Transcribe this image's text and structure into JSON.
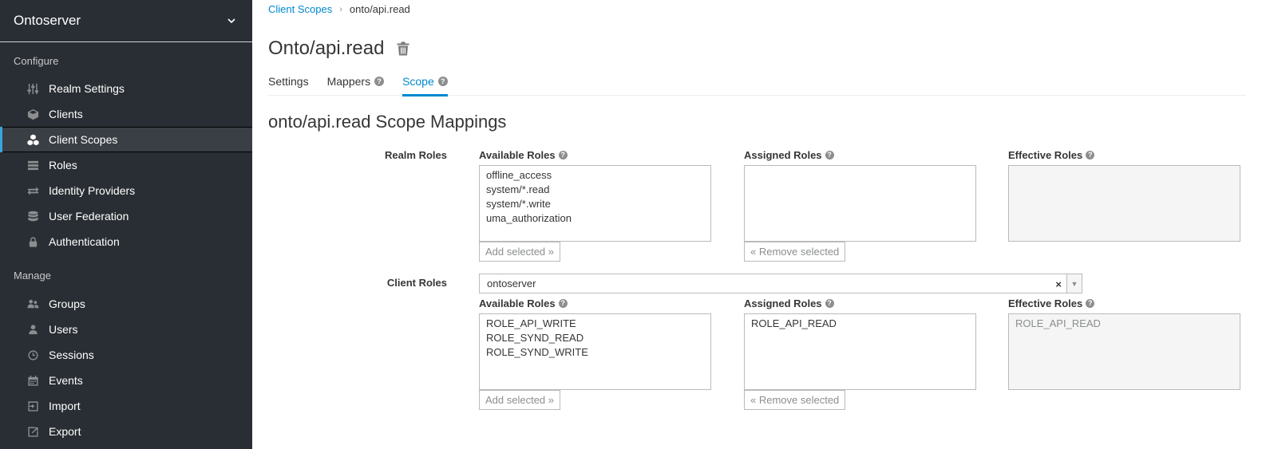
{
  "sidebar": {
    "realm": "Ontoserver",
    "configure_title": "Configure",
    "manage_title": "Manage",
    "configure_items": [
      {
        "label": "Realm Settings",
        "icon": "sliders-icon"
      },
      {
        "label": "Clients",
        "icon": "cube-icon"
      },
      {
        "label": "Client Scopes",
        "icon": "cubes-icon"
      },
      {
        "label": "Roles",
        "icon": "list-icon"
      },
      {
        "label": "Identity Providers",
        "icon": "exchange-icon"
      },
      {
        "label": "User Federation",
        "icon": "database-icon"
      },
      {
        "label": "Authentication",
        "icon": "lock-icon"
      }
    ],
    "manage_items": [
      {
        "label": "Groups",
        "icon": "users-icon"
      },
      {
        "label": "Users",
        "icon": "user-icon"
      },
      {
        "label": "Sessions",
        "icon": "clock-icon"
      },
      {
        "label": "Events",
        "icon": "calendar-icon"
      },
      {
        "label": "Import",
        "icon": "import-icon"
      },
      {
        "label": "Export",
        "icon": "export-icon"
      }
    ],
    "active_item": "Client Scopes",
    "accent_color": "#39a5dc"
  },
  "breadcrumb": {
    "parent": "Client Scopes",
    "current": "onto/api.read"
  },
  "page": {
    "title": "Onto/api.read",
    "tabs": [
      {
        "label": "Settings",
        "help": false
      },
      {
        "label": "Mappers",
        "help": true
      },
      {
        "label": "Scope",
        "help": true,
        "active": true
      }
    ],
    "section_title": "onto/api.read Scope Mappings"
  },
  "realm_roles": {
    "label": "Realm Roles",
    "available_label": "Available Roles",
    "assigned_label": "Assigned Roles",
    "effective_label": "Effective Roles",
    "available": [
      "offline_access",
      "system/*.read",
      "system/*.write",
      "uma_authorization"
    ],
    "assigned": [],
    "effective": [],
    "add_button": "Add selected »",
    "remove_button": "« Remove selected"
  },
  "client_roles": {
    "label": "Client Roles",
    "selected_client": "ontoserver",
    "clear_glyph": "×",
    "available_label": "Available Roles",
    "assigned_label": "Assigned Roles",
    "effective_label": "Effective Roles",
    "available": [
      "ROLE_API_WRITE",
      "ROLE_SYND_READ",
      "ROLE_SYND_WRITE"
    ],
    "assigned": [
      "ROLE_API_READ"
    ],
    "effective": [
      "ROLE_API_READ"
    ],
    "add_button": "Add selected »",
    "remove_button": "« Remove selected"
  },
  "colors": {
    "link": "#0088ce",
    "sidebar_bg": "#292e34"
  }
}
